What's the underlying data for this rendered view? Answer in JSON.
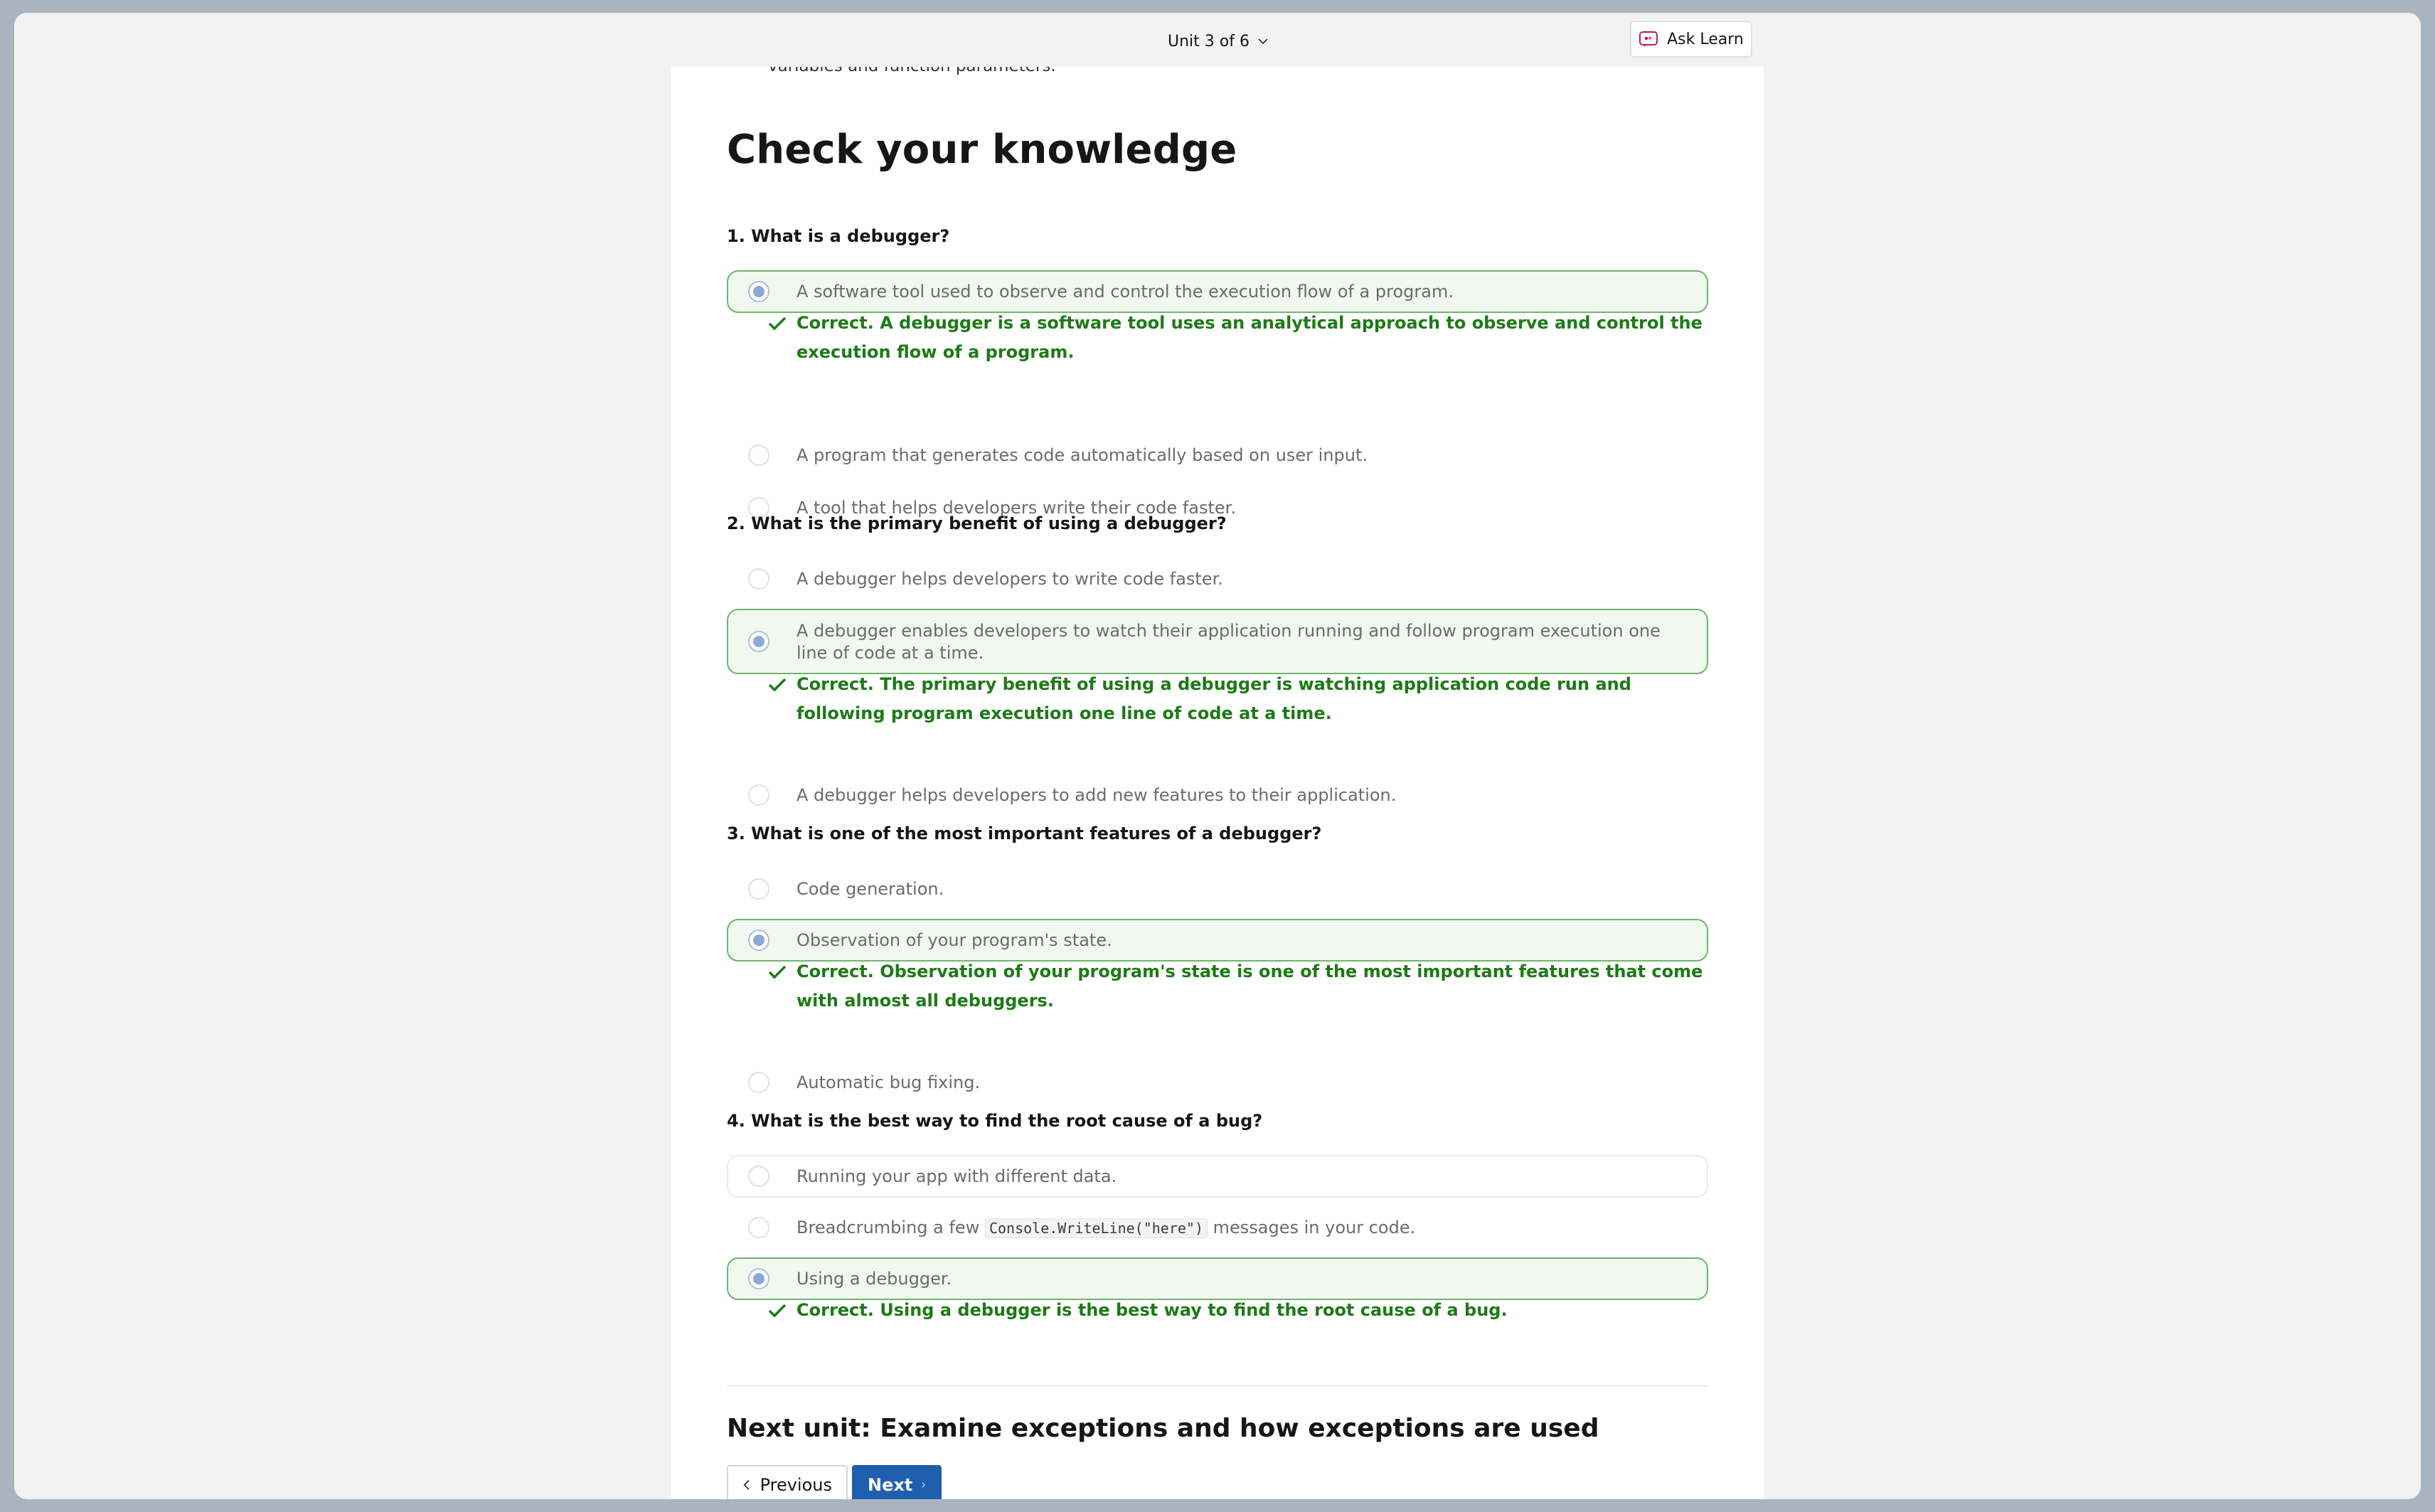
{
  "header": {
    "unit_selector": "Unit 3 of 6",
    "ask_learn": "Ask Learn"
  },
  "content": {
    "partial_line": "variables and function parameters.",
    "title": "Check your knowledge",
    "questions": [
      {
        "text": "1. What is a debugger?",
        "options": [
          "A software tool used to observe and control the execution flow of a program.",
          "A program that generates code automatically based on user input.",
          "A tool that helps developers write their code faster."
        ],
        "selected_index": 0,
        "feedback": "Correct. A debugger is a software tool uses an analytical approach to observe and control the execution flow of a program."
      },
      {
        "text": "2. What is the primary benefit of using a debugger?",
        "options": [
          "A debugger helps developers to write code faster.",
          "A debugger enables developers to watch their application running and follow program execution one line of code at a time.",
          "A debugger helps developers to add new features to their application."
        ],
        "selected_index": 1,
        "feedback": "Correct. The primary benefit of using a debugger is watching application code run and following program execution one line of code at a time."
      },
      {
        "text": "3. What is one of the most important features of a debugger?",
        "options": [
          "Code generation.",
          "Observation of your program's state.",
          "Automatic bug fixing."
        ],
        "selected_index": 1,
        "feedback": "Correct. Observation of your program's state is one of the most important features that come with almost all debuggers."
      },
      {
        "text": "4. What is the best way to find the root cause of a bug?",
        "options": [
          "Running your app with different data.",
          "Breadcrumbing a few",
          "Using a debugger."
        ],
        "option_2_code": "Console.WriteLine(\"here\")",
        "option_2_suffix": "messages in your code.",
        "selected_index": 2,
        "feedback": "Correct. Using a debugger is the best way to find the root cause of a bug."
      }
    ],
    "next_unit": "Next unit: Examine exceptions and how exceptions are used"
  },
  "navigation": {
    "previous": "Previous",
    "next": "Next"
  },
  "colors": {
    "correct_green": "#1d7a16",
    "selected_bg": "#f0f8ef",
    "primary_blue": "#1f5fae"
  }
}
